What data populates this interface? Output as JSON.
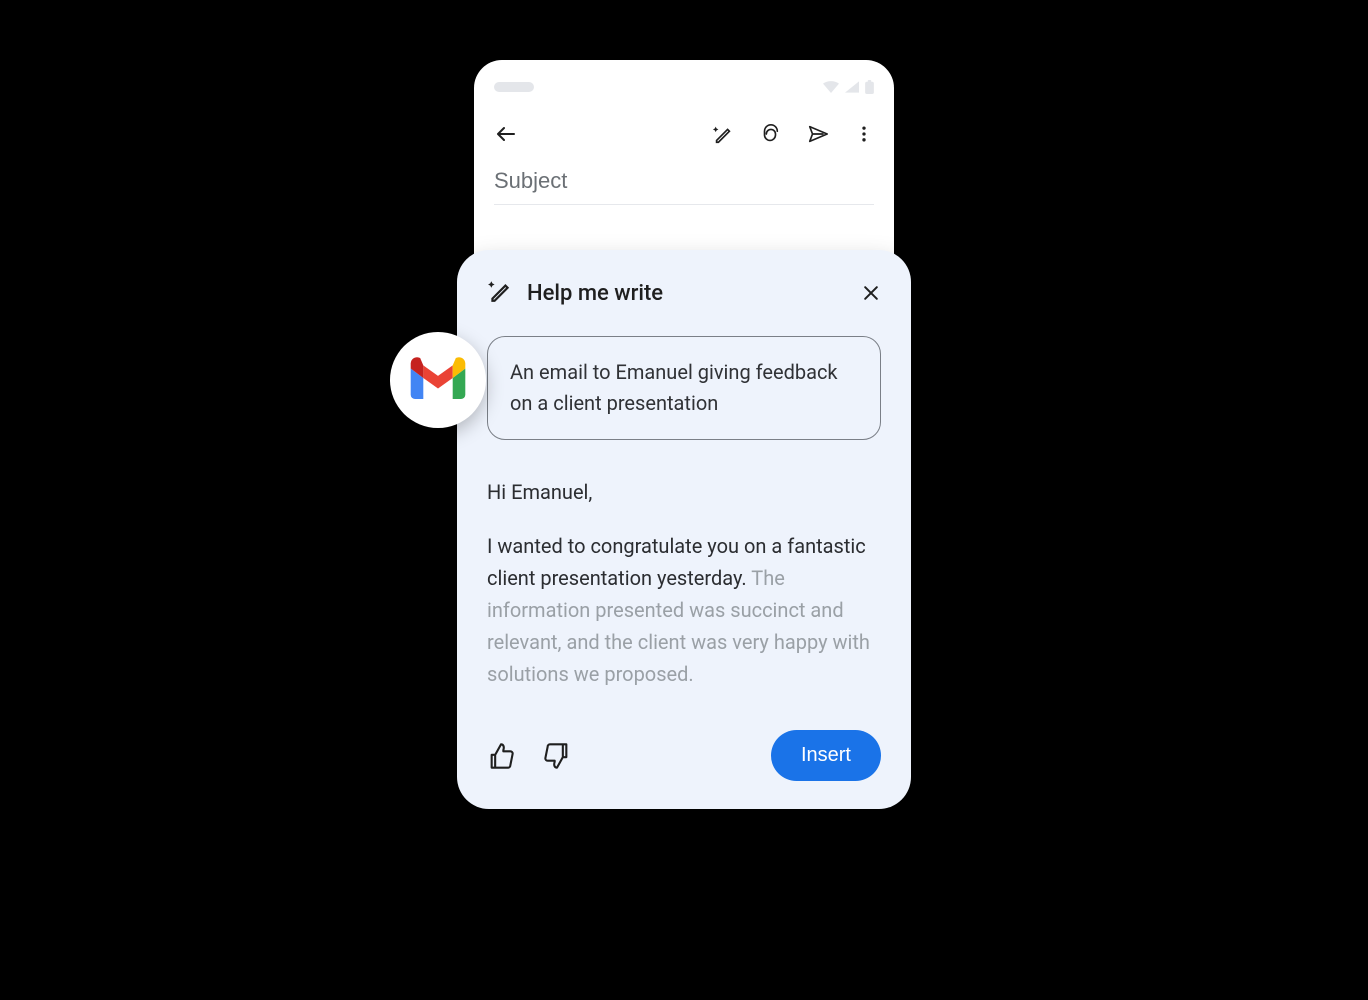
{
  "compose": {
    "subject_placeholder": "Subject"
  },
  "hmw": {
    "title": "Help me write",
    "prompt": "An email to Emanuel giving feedback on a client presentation",
    "greeting": "Hi Emanuel,",
    "paragraph_dark": "I wanted to congratulate you on a fantastic client presentation yesterday. ",
    "paragraph_light": "The information presented was succinct and relevant, and the client was very happy with solutions we proposed.",
    "insert_label": "Insert"
  },
  "icons": {
    "gmail": "gmail-icon",
    "back": "back-arrow-icon",
    "magic": "magic-pen-icon",
    "attach": "attachment-icon",
    "send": "send-icon",
    "more": "more-vert-icon",
    "close": "close-icon",
    "thumb_up": "thumb-up-icon",
    "thumb_down": "thumb-down-icon",
    "wifi": "wifi-icon",
    "signal": "cell-signal-icon",
    "battery": "battery-icon"
  }
}
